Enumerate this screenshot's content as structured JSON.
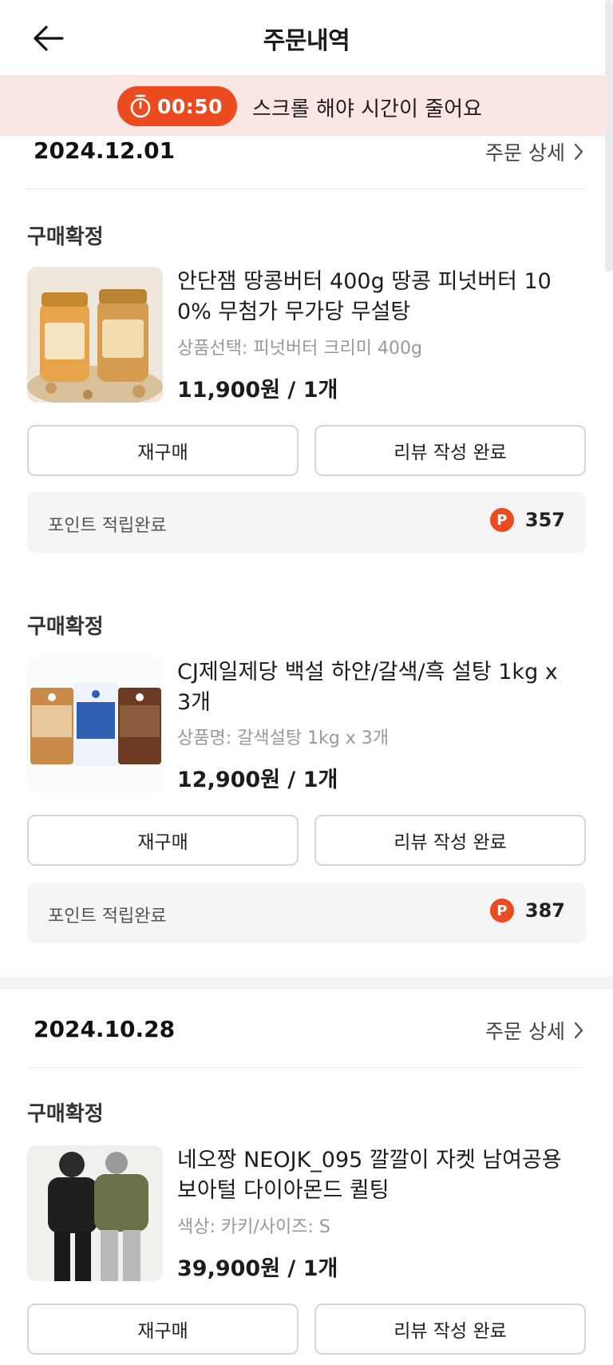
{
  "header": {
    "title": "주문내역"
  },
  "timer": {
    "value": "00:50",
    "message": "스크롤 해야 시간이 줄어요"
  },
  "orders": [
    {
      "date": "2024.12.01",
      "detail_label": "주문 상세",
      "items": [
        {
          "status": "구매확정",
          "name_line1": "안단잼 땅콩버터 400g 땅콩 피넛버터 10",
          "name_line2": "0% 무첨가 무가당 무설탕",
          "option": "상품선택: 피넛버터 크리미 400g",
          "price": "11,900원 / 1개",
          "rebuy": "재구매",
          "review": "리뷰 작성 완료",
          "points_label": "포인트 적립완료",
          "points_badge": "P",
          "points": "357"
        },
        {
          "status": "구매확정",
          "name_line1": "CJ제일제당 백설 하얀/갈색/흑 설탕 1kg x",
          "name_line2": "3개",
          "option": "상품명: 갈색설탕 1kg x 3개",
          "price": "12,900원 / 1개",
          "rebuy": "재구매",
          "review": "리뷰 작성 완료",
          "points_label": "포인트 적립완료",
          "points_badge": "P",
          "points": "387"
        }
      ]
    },
    {
      "date": "2024.10.28",
      "detail_label": "주문 상세",
      "items": [
        {
          "status": "구매확정",
          "name_line1": "네오짱 NEOJK_095 깔깔이 자켓 남여공용",
          "name_line2": "보아털 다이아몬드 퀼팅",
          "option": "색상: 카키/사이즈: S",
          "price": "39,900원 / 1개",
          "rebuy": "재구매",
          "review": "리뷰 작성 완료"
        }
      ]
    }
  ],
  "images": {
    "item1": "peanut-butter-jars",
    "item2": "sugar-bags",
    "item3": "padded-jackets"
  }
}
